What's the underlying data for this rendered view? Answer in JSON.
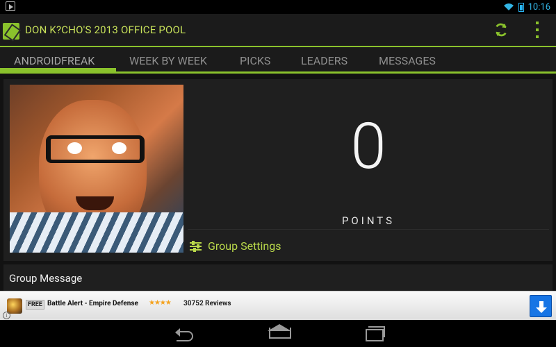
{
  "status_bar": {
    "time": "10:16",
    "left_icon": "play-store-icon",
    "wifi_icon": "wifi-icon",
    "battery_icon": "battery-icon"
  },
  "header": {
    "title": "DON K?CHO'S 2013 OFFICE POOL",
    "accent_color": "#8ac22c",
    "refresh_icon": "refresh-icon",
    "overflow_icon": "overflow-menu-icon"
  },
  "tabs": [
    {
      "label": "ANDROIDFREAK",
      "active": true
    },
    {
      "label": "WEEK BY WEEK",
      "active": false
    },
    {
      "label": "PICKS",
      "active": false
    },
    {
      "label": "LEADERS",
      "active": false
    },
    {
      "label": "MESSAGES",
      "active": false
    }
  ],
  "profile": {
    "points_value": "0",
    "points_label": "POINTS",
    "settings_label": "Group Settings",
    "settings_icon": "tune-icon"
  },
  "group_message": {
    "label": "Group Message"
  },
  "ad": {
    "badge": "FREE",
    "title": "Battle Alert - Empire Defense",
    "stars": "★★★★",
    "rating_value": 4,
    "reviews": "30752 Reviews",
    "download_icon": "download-icon"
  },
  "navigation": {
    "back_icon": "back-icon",
    "home_icon": "home-icon",
    "recent_icon": "recent-apps-icon"
  }
}
